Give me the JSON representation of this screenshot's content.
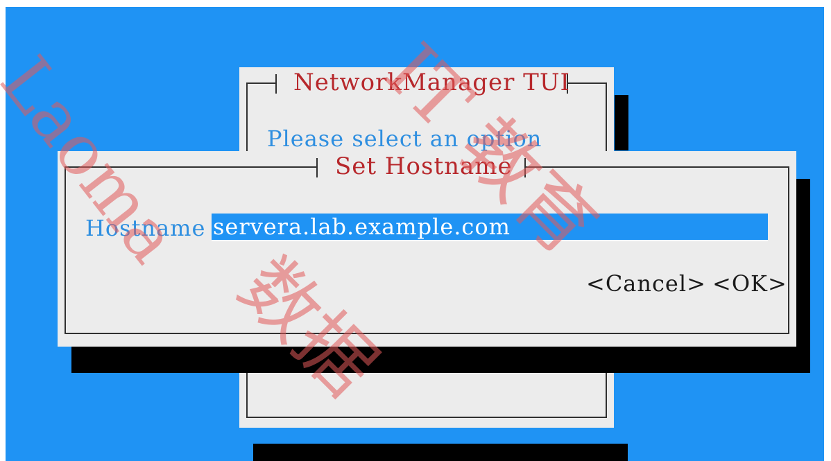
{
  "background_dialog": {
    "title": "NetworkManager TUI",
    "subtitle": "Please select an option"
  },
  "hostname_dialog": {
    "title": "Set Hostname",
    "field_label": "Hostname",
    "field_value": "servera.lab.example.com",
    "cancel_label": "<Cancel>",
    "ok_label": "<OK>"
  },
  "watermark": {
    "line1": "Laoma",
    "line2": "IT 教育",
    "line3": "数据"
  },
  "colors": {
    "screen_background": "#1f93f4",
    "panel": "#ececec",
    "title_text": "#b7282c",
    "label_text": "#2f8fe0",
    "input_background": "#1f93f4",
    "shadow": "#000000",
    "watermark": "#e25a5a"
  }
}
